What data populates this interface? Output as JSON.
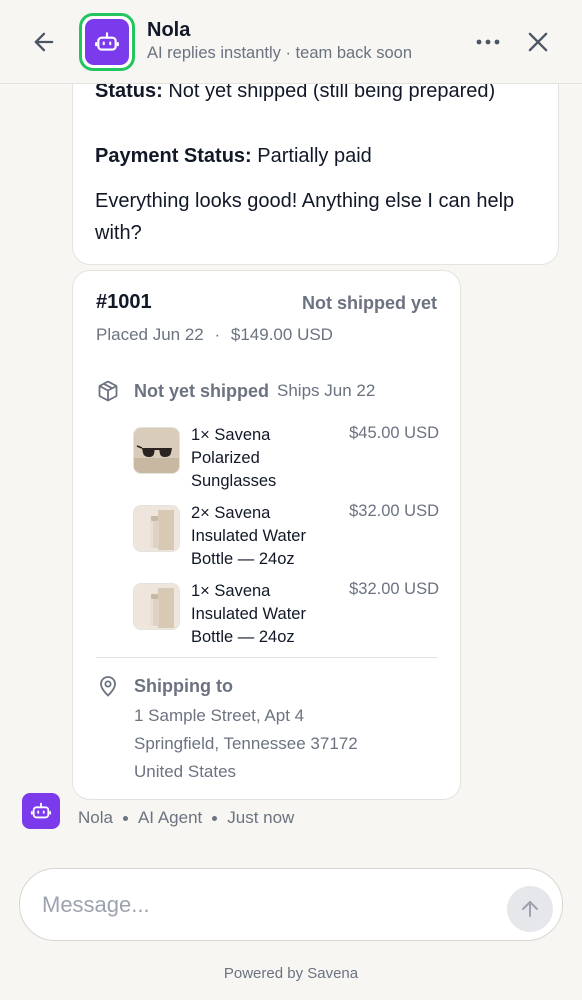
{
  "header": {
    "agent_name": "Nola",
    "subtitle": "AI replies instantly · team back soon"
  },
  "message": {
    "status_label": "Status:",
    "status_value": "Not yet shipped (still being prepared)",
    "payment_label": "Payment Status:",
    "payment_value": "Partially paid",
    "closing": "Everything looks good! Anything else I can help with?"
  },
  "order": {
    "id": "#1001",
    "status": "Not shipped yet",
    "placed": "Placed Jun 22",
    "total": "$149.00 USD",
    "fulfillment_title": "Not yet shipped",
    "ships_date": "Ships Jun 22",
    "items": [
      {
        "name": "1× Savena Polarized Sunglasses",
        "price": "$45.00 USD",
        "icon": "sunglasses-thumbnail"
      },
      {
        "name": "2× Savena Insulated Water Bottle — 24oz",
        "price": "$32.00 USD",
        "icon": "water-bottle-thumbnail"
      },
      {
        "name": "1× Savena Insulated Water Bottle — 24oz",
        "price": "$32.00 USD",
        "icon": "water-bottle-thumbnail"
      }
    ],
    "shipping_title": "Shipping to",
    "address": {
      "line1": "1 Sample Street, Apt 4",
      "line2": "Springfield, Tennessee 37172",
      "line3": "United States"
    }
  },
  "agent_meta": {
    "name": "Nola",
    "role": "AI Agent",
    "time": "Just now"
  },
  "composer": {
    "placeholder": "Message..."
  },
  "footer": {
    "powered_by": "Powered by Savena"
  },
  "colors": {
    "accent": "#7c3aed",
    "online_ring": "#22c55e",
    "background": "#f7f6f3"
  }
}
